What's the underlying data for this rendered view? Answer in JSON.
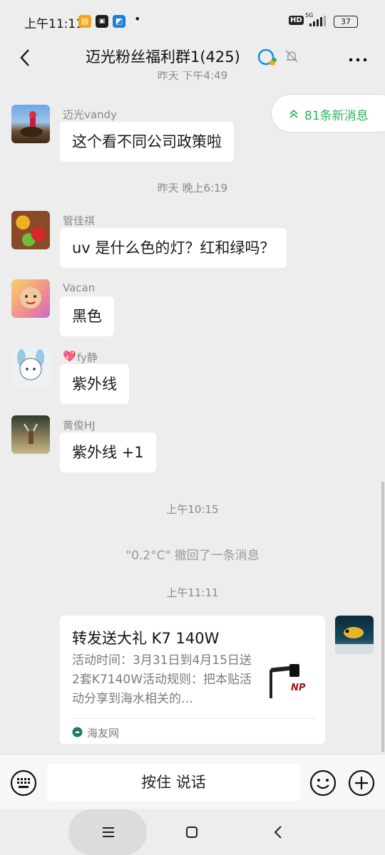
{
  "status_bar": {
    "time": "上午11:11",
    "app_icons": [
      "pay-app-icon",
      "unionpay-icon",
      "notes-app-icon"
    ],
    "dot": "•",
    "network": "5G",
    "hd": "HD",
    "battery": "37"
  },
  "header": {
    "title": "迈光粉丝福利群1(425)",
    "muted": true
  },
  "new_messages_pill": {
    "label": "81条新消息"
  },
  "partial_time": "昨天 下午4:49",
  "messages": [
    {
      "sender": "迈光vandy",
      "text": "这个看不同公司政策啦"
    },
    {
      "time": "昨天 晚上6:19"
    },
    {
      "sender": "管佳祺",
      "text": "uv 是什么色的灯？红和绿吗？"
    },
    {
      "sender": "Vacan",
      "text": "黑色"
    },
    {
      "sender": "fy静",
      "text": "紫外线"
    },
    {
      "sender": "黄俊HJ",
      "text": "紫外线 +1"
    }
  ],
  "time_2": "上午10:15",
  "recall_notice": "\"0.2°C\" 撤回了一条消息",
  "time_3": "上午11:11",
  "card": {
    "title": "转发送大礼 K7 140W",
    "desc": "活动时间：3月31日到4月15日送2套K7140W活动规则：把本贴活动分享到海水相关的…",
    "source": "海友网",
    "thumb_brand": "NP"
  },
  "input_bar": {
    "hold_label": "按住 说话"
  },
  "colors": {
    "accent_green": "#2db45a",
    "background": "#ededed",
    "bubble": "#ffffff"
  }
}
